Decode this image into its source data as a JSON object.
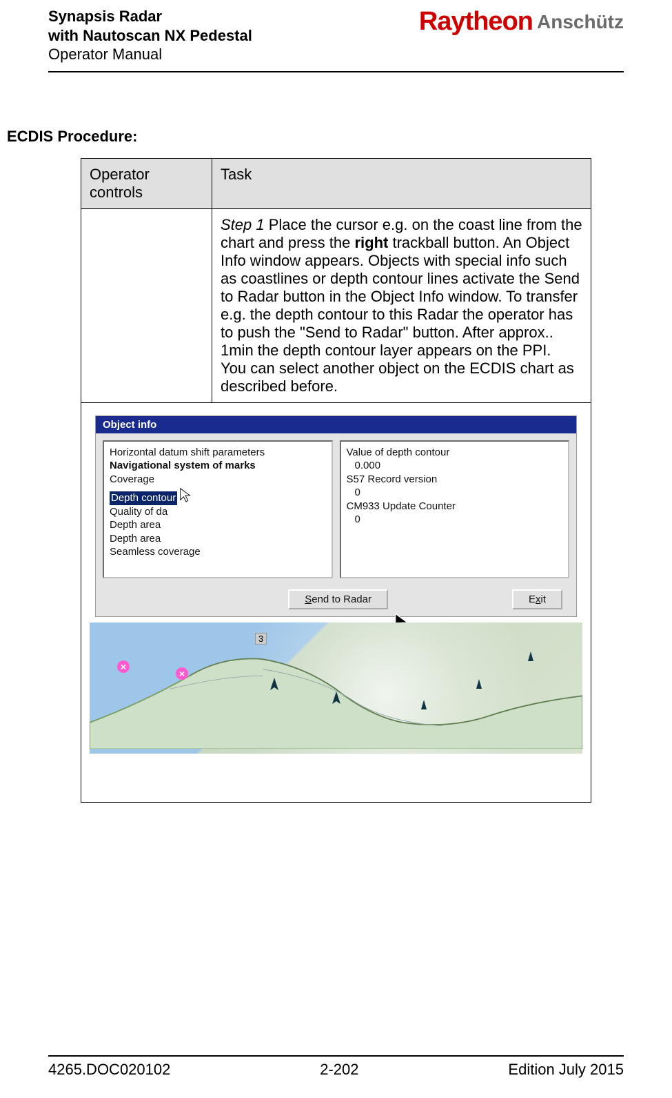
{
  "header": {
    "line1": "Synapsis Radar",
    "line2": "with Nautoscan NX Pedestal",
    "line3": "Operator Manual",
    "brand_left": "Raytheon",
    "brand_right": "Anschütz"
  },
  "section_title": "ECDIS Procedure:",
  "table": {
    "head_col1": "Operator controls",
    "head_col2": "Task",
    "step1": {
      "prefix": "Step 1",
      "text_a": " Place the cursor e.g. on the coast line from the chart and press the ",
      "bold1": "right",
      "text_b": " trackball button. An Object Info window appears. Objects with special info such as coastlines or depth contour lines activate the Send to Radar button in the Object Info window. To transfer e.g. the depth contour to this Radar the operator has to push the \"Send to Radar\" button. After approx.. 1min the depth contour layer appears on the PPI.",
      "line2": "You can select another object on the ECDIS chart as described before."
    }
  },
  "app": {
    "titlebar": "Object info",
    "left_panel": {
      "items": [
        "Horizontal datum shift parameters",
        "Navigational system of marks",
        "Coverage",
        "Depth contour",
        "Quality of da",
        "Depth area",
        "Depth area",
        "Seamless coverage"
      ],
      "bold_indexes": [
        1
      ],
      "selected_index": 3
    },
    "right_panel": {
      "label1": "Value of depth contour",
      "val1": "0.000",
      "label2": "S57 Record version",
      "val2": "0",
      "label3": "CM933 Update Counter",
      "val3": "0"
    },
    "buttons": {
      "send_prefix": "S",
      "send_rest": "end to Radar",
      "exit_pre": "E",
      "exit_mid": "x",
      "exit_post": "it"
    },
    "map_labels": {
      "p3": "3"
    }
  },
  "footer": {
    "left": "4265.DOC020102",
    "center": "2-202",
    "right": "Edition July 2015"
  }
}
